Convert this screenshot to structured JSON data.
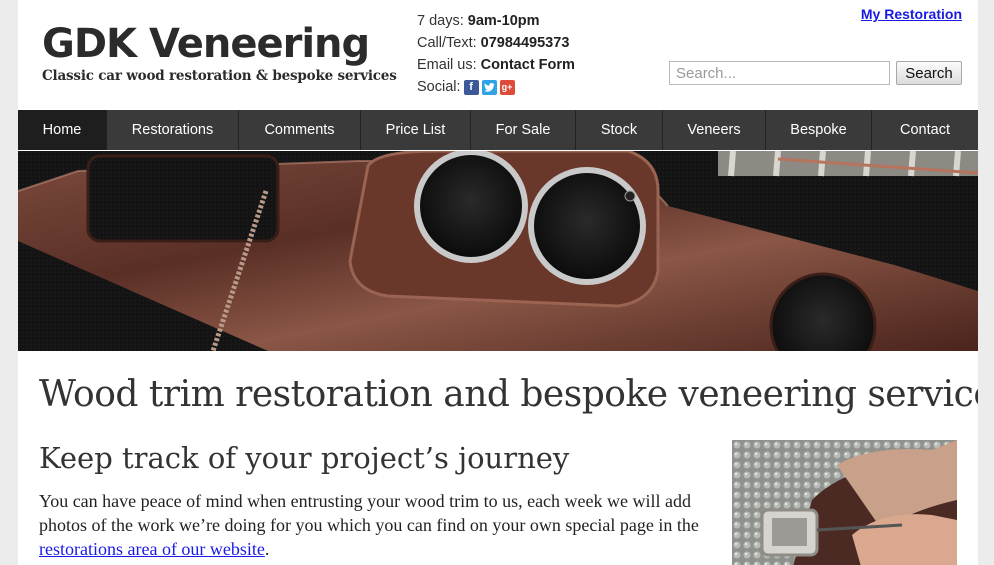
{
  "header": {
    "logo_title": "GDK Veneering",
    "logo_tagline": "Classic car wood restoration & bespoke services",
    "hours_label": "7 days: ",
    "hours_value": "9am-10pm",
    "phone_label": "Call/Text: ",
    "phone_value": "07984495373",
    "email_label": "Email us: ",
    "email_value": "Contact Form",
    "social_label": "Social: ",
    "my_restoration_link": "My Restoration"
  },
  "search": {
    "placeholder": "Search...",
    "button_label": "Search"
  },
  "nav": {
    "items": [
      {
        "label": "Home"
      },
      {
        "label": "Restorations"
      },
      {
        "label": "Comments"
      },
      {
        "label": "Price List"
      },
      {
        "label": "For Sale"
      },
      {
        "label": "Stock"
      },
      {
        "label": "Veneers"
      },
      {
        "label": "Bespoke"
      },
      {
        "label": "Contact"
      }
    ]
  },
  "main": {
    "heading": "Wood trim restoration and bespoke veneering services",
    "subheading": "Keep track of your project’s journey",
    "paragraph_text": "You can have peace of mind when entrusting your wood trim to us, each week we will add photos of the work we’re doing for you which you can find on your own special page in the ",
    "paragraph_link": "restorations area of our website",
    "paragraph_end": "."
  },
  "icons": {
    "social": [
      "facebook-icon",
      "twitter-icon",
      "google-plus-icon"
    ]
  },
  "colors": {
    "nav_background": "#3a3a3a",
    "nav_active": "#1e1e1e",
    "link": "#1a1ae6",
    "facebook": "#3b5998",
    "twitter": "#2fa3e6",
    "google_plus": "#dd4b39"
  }
}
